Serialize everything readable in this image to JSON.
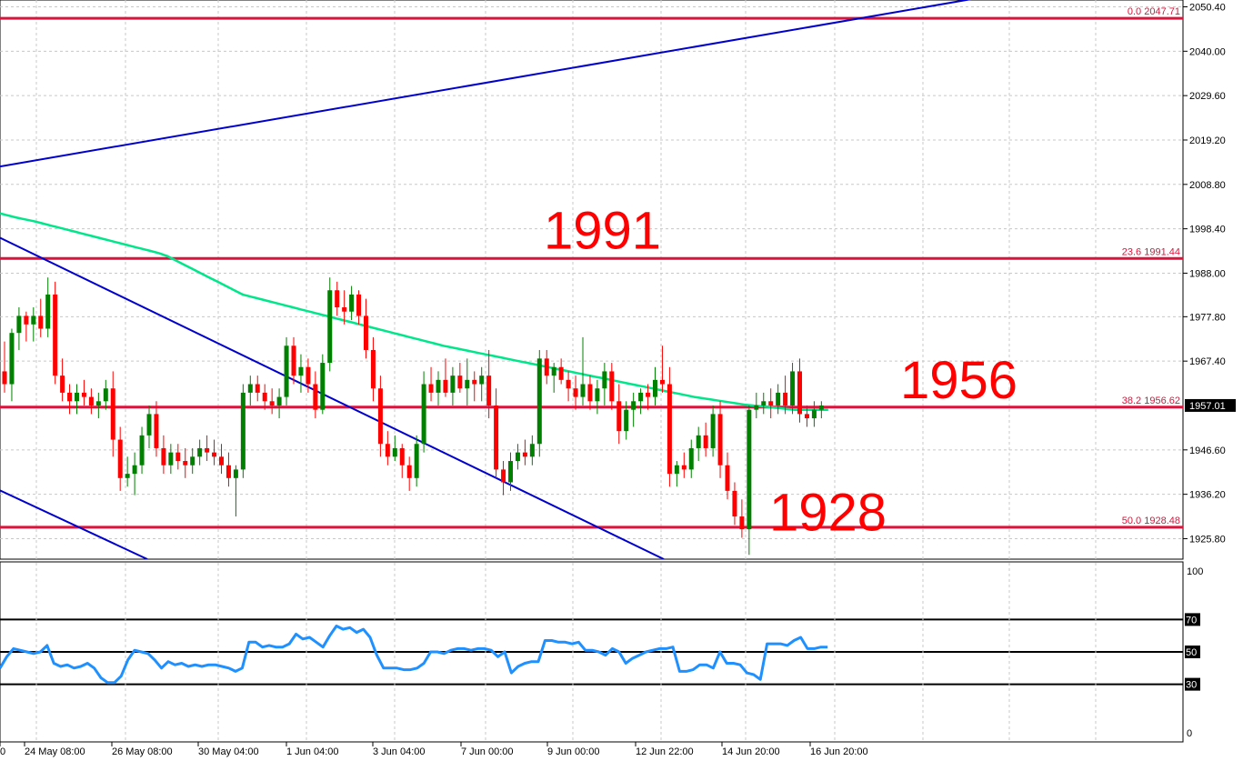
{
  "chart_data": [
    {
      "type": "candlestick",
      "ylim": [
        1921.0,
        2052.0
      ],
      "y_ticks": [
        "2050.40",
        "2040.00",
        "2029.60",
        "2019.20",
        "2008.80",
        "1998.40",
        "1988.00",
        "1977.80",
        "1967.40",
        "1957.01",
        "1946.60",
        "1936.20",
        "1925.80"
      ],
      "current_price": "1957.01",
      "colors": {
        "bull": "#008000",
        "bear": "#ff0000",
        "fib": "#dc143c",
        "trend": "#0000cd",
        "ma": "#00e68a",
        "annotation": "#ff0000"
      },
      "fib_levels": [
        {
          "label": "0.0 2047.71",
          "value": 2047.71
        },
        {
          "label": "23.6 1991.44",
          "value": 1991.44
        },
        {
          "label": "38.2 1956.62",
          "value": 1956.62
        },
        {
          "label": "50.0 1928.48",
          "value": 1928.48
        }
      ],
      "annotations": [
        {
          "text": "1991",
          "value": 1998
        },
        {
          "text": "1956",
          "value": 1963
        },
        {
          "text": "1928",
          "value": 1932
        }
      ],
      "candles_ohlc": [
        [
          1965,
          1972,
          1960,
          1962
        ],
        [
          1962,
          1975,
          1958,
          1974
        ],
        [
          1974,
          1980,
          1970,
          1978
        ],
        [
          1978,
          1979,
          1972,
          1976
        ],
        [
          1976,
          1980,
          1972,
          1978
        ],
        [
          1978,
          1982,
          1973,
          1975
        ],
        [
          1975,
          1987,
          1973,
          1983
        ],
        [
          1983,
          1986,
          1962,
          1964
        ],
        [
          1964,
          1968,
          1958,
          1960
        ],
        [
          1960,
          1962,
          1955,
          1958
        ],
        [
          1958,
          1962,
          1955,
          1960
        ],
        [
          1960,
          1963,
          1957,
          1959
        ],
        [
          1959,
          1961,
          1955,
          1957
        ],
        [
          1957,
          1960,
          1954,
          1958
        ],
        [
          1958,
          1963,
          1956,
          1961
        ],
        [
          1961,
          1965,
          1945,
          1949
        ],
        [
          1949,
          1952,
          1937,
          1940
        ],
        [
          1940,
          1945,
          1938,
          1941
        ],
        [
          1941,
          1946,
          1936,
          1943
        ],
        [
          1943,
          1952,
          1941,
          1950
        ],
        [
          1950,
          1957,
          1947,
          1955
        ],
        [
          1955,
          1958,
          1945,
          1947
        ],
        [
          1947,
          1950,
          1941,
          1943
        ],
        [
          1943,
          1948,
          1941,
          1946
        ],
        [
          1946,
          1948,
          1942,
          1944
        ],
        [
          1944,
          1947,
          1940,
          1943
        ],
        [
          1943,
          1947,
          1941,
          1945
        ],
        [
          1945,
          1949,
          1943,
          1947
        ],
        [
          1947,
          1950,
          1944,
          1946
        ],
        [
          1946,
          1949,
          1943,
          1945
        ],
        [
          1945,
          1948,
          1941,
          1943
        ],
        [
          1943,
          1946,
          1938,
          1940
        ],
        [
          1940,
          1943,
          1931,
          1942
        ],
        [
          1942,
          1962,
          1940,
          1960
        ],
        [
          1960,
          1964,
          1957,
          1962
        ],
        [
          1962,
          1964,
          1958,
          1960
        ],
        [
          1960,
          1962,
          1956,
          1958
        ],
        [
          1958,
          1961,
          1955,
          1957
        ],
        [
          1957,
          1961,
          1954,
          1959
        ],
        [
          1959,
          1973,
          1957,
          1971
        ],
        [
          1971,
          1973,
          1962,
          1964
        ],
        [
          1964,
          1969,
          1960,
          1966
        ],
        [
          1966,
          1968,
          1960,
          1962
        ],
        [
          1962,
          1965,
          1954,
          1956
        ],
        [
          1956,
          1969,
          1955,
          1967
        ],
        [
          1967,
          1987,
          1965,
          1984
        ],
        [
          1984,
          1986,
          1978,
          1980
        ],
        [
          1980,
          1984,
          1976,
          1979
        ],
        [
          1979,
          1985,
          1977,
          1983
        ],
        [
          1983,
          1984,
          1976,
          1978
        ],
        [
          1978,
          1982,
          1968,
          1970
        ],
        [
          1970,
          1973,
          1958,
          1961
        ],
        [
          1961,
          1964,
          1945,
          1948
        ],
        [
          1948,
          1951,
          1943,
          1945
        ],
        [
          1945,
          1950,
          1944,
          1947
        ],
        [
          1947,
          1948,
          1940,
          1943
        ],
        [
          1943,
          1945,
          1937,
          1940
        ],
        [
          1940,
          1950,
          1938,
          1948
        ],
        [
          1948,
          1965,
          1946,
          1962
        ],
        [
          1962,
          1966,
          1958,
          1960
        ],
        [
          1960,
          1965,
          1957,
          1963
        ],
        [
          1963,
          1968,
          1959,
          1960
        ],
        [
          1960,
          1966,
          1957,
          1964
        ],
        [
          1964,
          1967,
          1960,
          1961
        ],
        [
          1961,
          1968,
          1957,
          1963
        ],
        [
          1963,
          1965,
          1958,
          1962
        ],
        [
          1962,
          1966,
          1958,
          1964
        ],
        [
          1964,
          1970,
          1954,
          1957
        ],
        [
          1957,
          1961,
          1940,
          1942
        ],
        [
          1942,
          1944,
          1936,
          1939
        ],
        [
          1939,
          1946,
          1937,
          1944
        ],
        [
          1944,
          1948,
          1942,
          1946
        ],
        [
          1946,
          1949,
          1943,
          1945
        ],
        [
          1945,
          1950,
          1943,
          1948
        ],
        [
          1948,
          1970,
          1945,
          1968
        ],
        [
          1968,
          1970,
          1962,
          1964
        ],
        [
          1964,
          1967,
          1960,
          1966
        ],
        [
          1966,
          1968,
          1962,
          1963
        ],
        [
          1963,
          1965,
          1958,
          1961
        ],
        [
          1961,
          1964,
          1956,
          1959
        ],
        [
          1959,
          1973,
          1957,
          1962
        ],
        [
          1962,
          1964,
          1956,
          1958
        ],
        [
          1958,
          1963,
          1955,
          1961
        ],
        [
          1961,
          1967,
          1957,
          1965
        ],
        [
          1965,
          1967,
          1956,
          1958
        ],
        [
          1958,
          1962,
          1948,
          1951
        ],
        [
          1951,
          1958,
          1949,
          1956
        ],
        [
          1956,
          1960,
          1952,
          1958
        ],
        [
          1958,
          1961,
          1955,
          1960
        ],
        [
          1960,
          1962,
          1956,
          1959
        ],
        [
          1959,
          1966,
          1957,
          1963
        ],
        [
          1963,
          1971,
          1960,
          1962
        ],
        [
          1962,
          1966,
          1938,
          1941
        ],
        [
          1941,
          1944,
          1938,
          1943
        ],
        [
          1943,
          1946,
          1940,
          1942
        ],
        [
          1942,
          1949,
          1940,
          1947
        ],
        [
          1947,
          1952,
          1944,
          1950
        ],
        [
          1950,
          1953,
          1945,
          1947
        ],
        [
          1947,
          1957,
          1945,
          1955
        ],
        [
          1955,
          1958,
          1940,
          1943
        ],
        [
          1943,
          1946,
          1935,
          1937
        ],
        [
          1937,
          1939,
          1929,
          1931
        ],
        [
          1931,
          1935,
          1926,
          1928
        ],
        [
          1928,
          1957,
          1922,
          1956
        ],
        [
          1956,
          1960,
          1954,
          1957
        ],
        [
          1957,
          1960,
          1955,
          1958
        ],
        [
          1958,
          1961,
          1954,
          1957
        ],
        [
          1957,
          1962,
          1955,
          1960
        ],
        [
          1960,
          1964,
          1955,
          1957
        ],
        [
          1957,
          1967,
          1955,
          1965
        ],
        [
          1965,
          1968,
          1953,
          1955
        ],
        [
          1955,
          1957,
          1952,
          1954
        ],
        [
          1954,
          1958,
          1952,
          1956
        ],
        [
          1956,
          1958,
          1954,
          1957
        ]
      ],
      "ma_values": [
        2002,
        2001.5,
        2001,
        2000.6,
        2000.2,
        1999.7,
        1999.2,
        1998.7,
        1998.2,
        1997.7,
        1997.2,
        1996.7,
        1996.2,
        1995.7,
        1995.2,
        1994.7,
        1994.2,
        1993.7,
        1993.2,
        1992.7,
        1992,
        1991,
        1990,
        1989,
        1988,
        1987,
        1986,
        1985,
        1984,
        1983,
        1982.5,
        1982,
        1981.5,
        1981,
        1980.5,
        1980,
        1979.5,
        1979,
        1978.5,
        1978,
        1977.5,
        1977,
        1976.5,
        1976,
        1975.5,
        1975,
        1974.5,
        1974,
        1973.5,
        1973,
        1972.5,
        1972,
        1971.5,
        1971,
        1970.6,
        1970.2,
        1969.8,
        1969.4,
        1969,
        1968.6,
        1968.2,
        1967.8,
        1967.4,
        1967,
        1966.6,
        1966.2,
        1965.8,
        1965.4,
        1965,
        1964.6,
        1964.2,
        1963.8,
        1963.4,
        1963,
        1962.6,
        1962.2,
        1961.8,
        1961.4,
        1961,
        1960.6,
        1960.2,
        1959.8,
        1959.4,
        1959,
        1958.7,
        1958.4,
        1958.1,
        1957.8,
        1957.5,
        1957.2,
        1957,
        1956.8,
        1956.6,
        1956.4,
        1956.2,
        1956,
        1956,
        1956,
        1956,
        1956
      ],
      "trendlines": [
        {
          "from": [
            0,
            2013.0
          ],
          "to": [
            1090,
            2053.0
          ]
        },
        {
          "from": [
            0,
            1996.3
          ],
          "to": [
            730,
            1921.0
          ]
        },
        {
          "from": [
            0,
            1937.1
          ],
          "to": [
            162,
            1921.0
          ]
        }
      ],
      "x_tick_labels": [
        "0",
        "24 May 08:00",
        "26 May 08:00",
        "30 May 04:00",
        "1 Jun 04:00",
        "3 Jun 04:00",
        "7 Jun 00:00",
        "9 Jun 00:00",
        "12 Jun 22:00",
        "14 Jun 20:00",
        "16 Jun 20:00"
      ]
    },
    {
      "type": "line",
      "name": "RSI",
      "ylim": [
        0,
        100
      ],
      "y_tick_labels": [
        "100",
        "70",
        "50",
        "30",
        "0"
      ],
      "levels": [
        70,
        50,
        30
      ],
      "values": [
        40,
        47,
        52,
        51,
        50,
        49,
        50,
        54,
        43,
        41,
        42,
        40,
        41,
        43,
        40,
        34,
        31,
        31,
        35,
        45,
        51,
        50,
        49,
        45,
        40,
        44,
        42,
        43,
        41,
        42,
        41,
        42,
        42,
        41,
        40,
        38,
        40,
        56,
        56,
        53,
        54,
        53,
        53,
        55,
        61,
        58,
        59,
        56,
        53,
        60,
        66,
        64,
        65,
        62,
        64,
        59,
        48,
        40,
        40,
        40,
        39,
        39,
        40,
        43,
        50,
        50,
        49,
        51,
        52,
        52,
        51,
        52,
        52,
        51,
        47,
        50,
        37,
        41,
        43,
        44,
        44,
        57,
        57,
        56,
        56,
        55,
        56,
        51,
        51,
        50,
        48,
        52,
        50,
        43,
        46,
        48,
        50,
        51,
        52,
        52,
        53,
        38,
        38,
        39,
        42,
        42,
        40,
        50,
        43,
        43,
        42,
        37,
        36,
        33,
        55,
        55,
        55,
        54,
        57,
        59,
        52,
        52,
        53,
        53
      ]
    }
  ]
}
